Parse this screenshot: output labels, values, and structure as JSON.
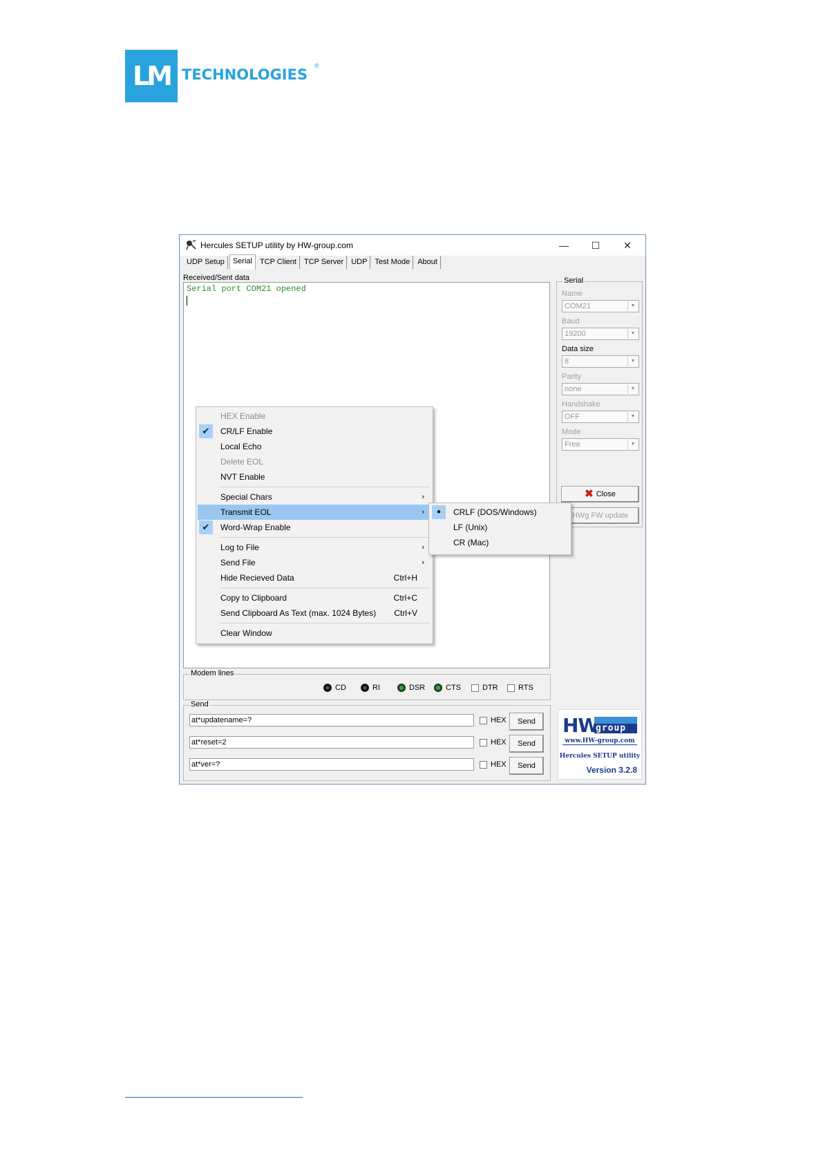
{
  "logo": {
    "mark": "LM",
    "text": "TECHNOLOGIES",
    "registered": "®"
  },
  "window": {
    "title": "Hercules SETUP utility by HW-group.com",
    "icon": "hercules-icon",
    "controls": {
      "minimize": "—",
      "maximize": "☐",
      "close": "✕"
    },
    "tabs": [
      "UDP Setup",
      "Serial",
      "TCP Client",
      "TCP Server",
      "UDP",
      "Test Mode",
      "About"
    ],
    "active_tab": "Serial"
  },
  "received": {
    "label": "Received/Sent data",
    "lines": [
      "Serial port COM21 opened"
    ]
  },
  "serial": {
    "group_title": "Serial",
    "name_label": "Name",
    "name_value": "COM21",
    "baud_label": "Baud",
    "baud_value": "19200",
    "datasize_label": "Data size",
    "datasize_value": "8",
    "parity_label": "Parity",
    "parity_value": "none",
    "handshake_label": "Handshake",
    "handshake_value": "OFF",
    "mode_label": "Mode",
    "mode_value": "Free",
    "close_label": "Close",
    "fw_update_label": "HWg FW update"
  },
  "modem": {
    "group_title": "Modem lines",
    "leds": [
      {
        "label": "CD",
        "state": "black"
      },
      {
        "label": "RI",
        "state": "black"
      },
      {
        "label": "DSR",
        "state": "green"
      },
      {
        "label": "CTS",
        "state": "green"
      }
    ],
    "checks": [
      "DTR",
      "RTS"
    ]
  },
  "send": {
    "group_title": "Send",
    "rows": [
      {
        "value": "at*updatename=?",
        "hex_label": "HEX",
        "button": "Send"
      },
      {
        "value": "at*reset=2",
        "hex_label": "HEX",
        "button": "Send"
      },
      {
        "value": "at*ver=?",
        "hex_label": "HEX",
        "button": "Send"
      }
    ]
  },
  "hwgroup": {
    "big": "HW",
    "group": "group",
    "url": "www.HW-group.com",
    "utility": "Hercules SETUP utility",
    "version": "Version  3.2.8"
  },
  "context_menu": {
    "items": [
      {
        "label": "HEX Enable",
        "disabled": true
      },
      {
        "label": "CR/LF Enable",
        "checked": true
      },
      {
        "label": "Local Echo"
      },
      {
        "label": "Delete EOL",
        "disabled": true
      },
      {
        "label": "NVT Enable"
      },
      {
        "label": "Special Chars",
        "submenu": true
      },
      {
        "label": "Transmit EOL",
        "submenu": true,
        "highlighted": true
      },
      {
        "label": "Word-Wrap Enable",
        "checked": true
      },
      {
        "label": "Log to File",
        "submenu": true
      },
      {
        "label": "Send File",
        "submenu": true
      },
      {
        "label": "Hide Recieved Data",
        "shortcut": "Ctrl+H"
      },
      {
        "label": "Copy to Clipboard",
        "shortcut": "Ctrl+C"
      },
      {
        "label": "Send Clipboard As Text (max. 1024 Bytes)",
        "shortcut": "Ctrl+V"
      },
      {
        "label": "Clear Window"
      }
    ],
    "arrow": "›",
    "check": "✔"
  },
  "eol_submenu": {
    "items": [
      "CRLF (DOS/Windows)",
      "LF (Unix)",
      "CR (Mac)"
    ],
    "selected": 0,
    "bullet": "●"
  },
  "colors": {
    "accent": "#29a3dd",
    "menu_highlight": "#9ac7f0",
    "led_green": "#3fa34d",
    "received_text": "#2e8b2e"
  }
}
